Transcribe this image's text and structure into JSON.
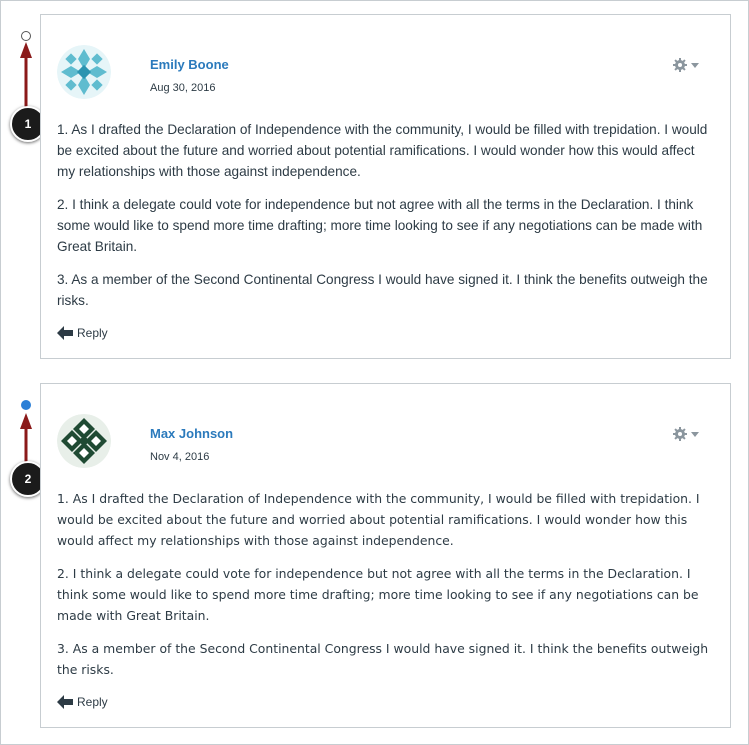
{
  "colors": {
    "link": "#2b7abc",
    "unread_dot": "#2b7fd6",
    "callout_arrow": "#8b1a1a",
    "text": "#2d3b45",
    "border": "#c7cdd1"
  },
  "callouts": [
    "1",
    "2"
  ],
  "posts": [
    {
      "author": "Emily Boone",
      "date": "Aug 30, 2016",
      "read_state": "read",
      "avatar_icon": "teal-geometric-avatar-icon",
      "paragraphs": [
        "1. As I drafted the Declaration of Independence with the community, I would be filled with trepidation. I would be excited about the future and worried about potential ramifications. I would wonder how this would affect my relationships with those against independence.",
        "2. I think a delegate could vote for independence but not agree with all the terms in the Declaration. I think some would like to spend more time drafting; more time looking to see if any negotiations can be made with Great Britain.",
        "3. As a member of the Second Continental Congress I would have signed it. I think the benefits outweigh the risks."
      ],
      "reply_label": "Reply"
    },
    {
      "author": "Max Johnson",
      "date": "Nov 4, 2016",
      "read_state": "unread",
      "avatar_icon": "green-geometric-avatar-icon",
      "paragraphs": [
        "1. As I drafted the Declaration of Independence with the community, I would be filled with trepidation. I would be excited about the future and worried about potential ramifications. I would wonder how this would affect my relationships with those against independence.",
        "2. I think a delegate could vote for independence but not agree with all the terms in the Declaration. I think some would like to spend more time drafting; more time looking to see if any negotiations can be made with Great Britain.",
        "3. As a member of the Second Continental Congress I would have signed it. I think the benefits outweigh the risks."
      ],
      "reply_label": "Reply"
    }
  ]
}
